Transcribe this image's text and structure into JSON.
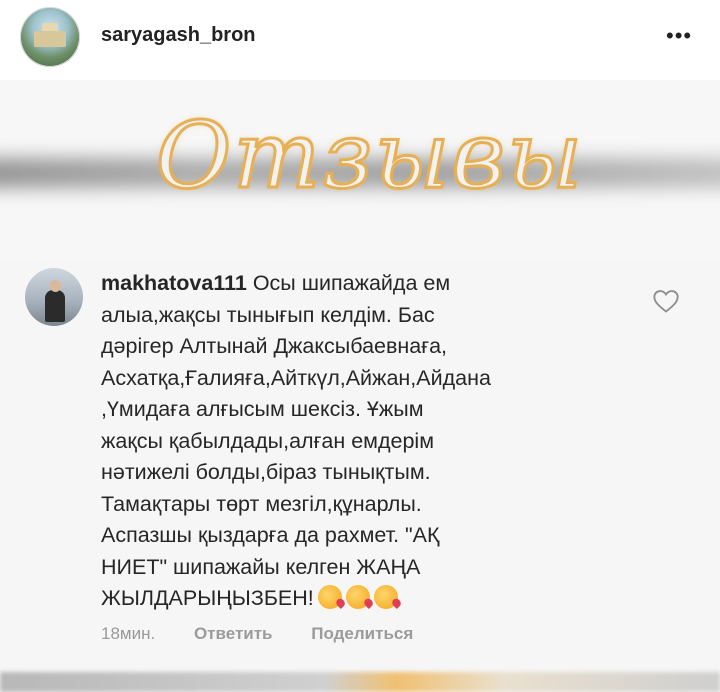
{
  "header": {
    "username": "saryagash_bron",
    "more_icon": "more-dots-icon",
    "more_glyph": "•••"
  },
  "banner": {
    "title": "Отзывы",
    "accent_color": "#e8b054"
  },
  "comment": {
    "username": "makhatova111",
    "lines": [
      "Осы шипажайда ем",
      "алыа,жақсы тынығып келдім. Бас",
      "дәрігер Алтынай Джаксыбаевнаға,",
      "Асхатқа,Ғалияға,Айткүл,Айжан,Айдана",
      ",Үмидаға алғысым шексіз. Ұжым",
      "жақсы қабылдады,алған емдерім",
      "нәтижелі болды,біраз тынықтым.",
      "Тамақтары төрт мезгіл,құнарлы.",
      "Аспазшы қыздарға да рахмет. \"АҚ",
      "НИЕТ\" шипажайы  келген ЖАҢА",
      "ЖЫЛДАРЫҢЫЗБЕН!"
    ],
    "emojis": [
      "kiss-emoji",
      "kiss-emoji",
      "kiss-emoji"
    ],
    "like_icon": "heart-icon",
    "time": "18мин.",
    "reply_label": "Ответить",
    "share_label": "Поделиться"
  }
}
